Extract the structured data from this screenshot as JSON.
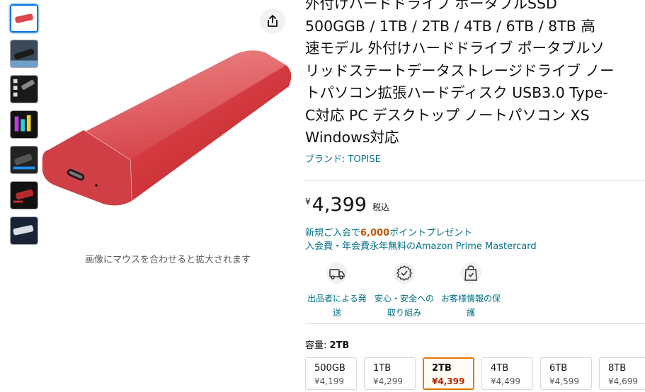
{
  "gallery": {
    "thumbnails": [
      {
        "name": "thumb-red-ssd",
        "selected": true
      },
      {
        "name": "thumb-black-ssd"
      },
      {
        "name": "thumb-ssd-spec-icons"
      },
      {
        "name": "thumb-ssd-compatibility"
      },
      {
        "name": "thumb-ssd-black-angle"
      },
      {
        "name": "thumb-ssd-red-dark"
      },
      {
        "name": "thumb-ssd-silver"
      }
    ],
    "zoom_hint": "画像にマウスを合わせると拡大されます"
  },
  "product": {
    "title_lines": [
      "外付けハードドライブ ポータブルSSD",
      "500GGB / 1TB / 2TB / 4TB / 6TB / 8TB 高",
      "速モデル 外付けハードドライブ ポータブルソ",
      "リッドステートデータストレージドライブ ノー",
      "トパソコン拡張ハードディスク USB3.0 Type-",
      "C対応 PC デスクトップ ノートパソコン XS",
      "Windows対応"
    ],
    "brand": "ブランド: TOPISE",
    "price_symbol": "¥",
    "price": "4,399",
    "tax_label": "税込",
    "promo_prefix": "新規ご入会で",
    "promo_points": "6,000",
    "promo_suffix": "ポイントプレゼント",
    "promo_line2": "入会費・年会費永年無料のAmazon Prime Mastercard"
  },
  "badges": [
    {
      "icon": "truck-icon",
      "label_1": "出品者による発",
      "label_2": "送"
    },
    {
      "icon": "shield-check-icon",
      "label_1": "安心・安全への",
      "label_2": "取り組み"
    },
    {
      "icon": "lock-bag-icon",
      "label_1": "お客様情報の保",
      "label_2": "護"
    }
  ],
  "capacity": {
    "label": "容量: ",
    "selected": "2TB",
    "options": [
      {
        "name": "500GB",
        "price": "¥4,199"
      },
      {
        "name": "1TB",
        "price": "¥4,299"
      },
      {
        "name": "2TB",
        "price": "¥4,399",
        "selected": true
      },
      {
        "name": "4TB",
        "price": "¥4,499"
      },
      {
        "name": "6TB",
        "price": "¥4,599"
      },
      {
        "name": "8TB",
        "price": "¥4,699"
      }
    ]
  },
  "colors": {
    "link": "#007185",
    "selected_border": "#e77600",
    "price_red": "#b12704",
    "product_red": "#d9474b"
  }
}
